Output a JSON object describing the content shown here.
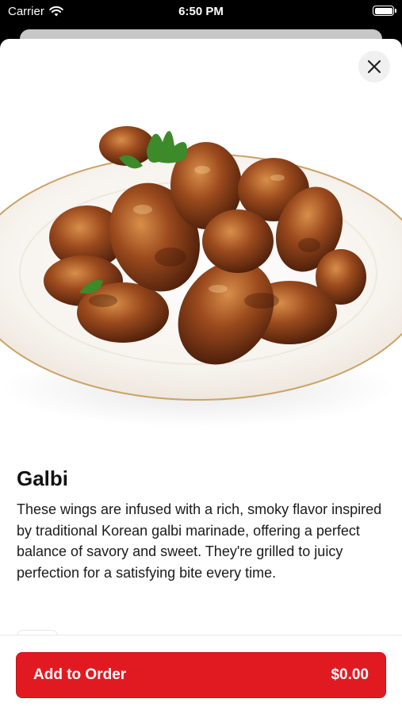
{
  "status_bar": {
    "carrier": "Carrier",
    "time": "6:50 PM"
  },
  "item": {
    "title": "Galbi",
    "description": "These wings are infused with a rich, smoky flavor inspired by traditional Korean galbi marinade, offering a perfect balance of savory and sweet. They're grilled to juicy perfection for a satisfying bite every time."
  },
  "footer": {
    "add_label": "Add to Order",
    "price": "$0.00"
  },
  "colors": {
    "accent": "#e11a22"
  },
  "icons": [
    "wifi-icon",
    "battery-icon",
    "close-icon"
  ]
}
